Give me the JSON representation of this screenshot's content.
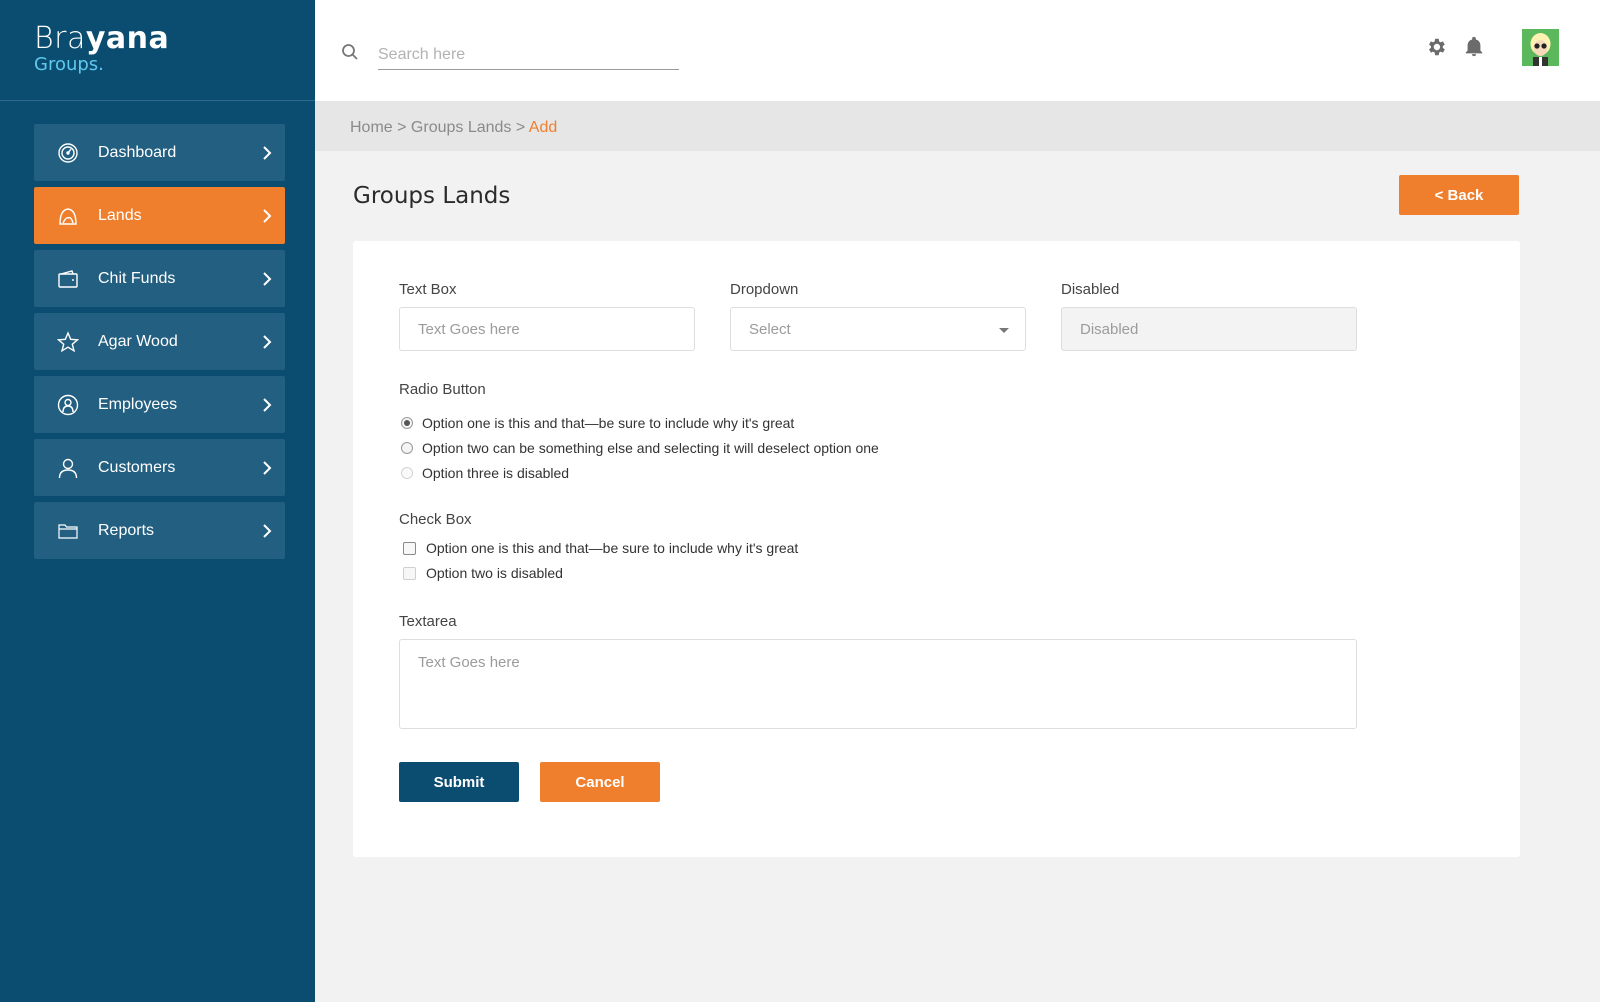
{
  "brand": {
    "name_light": "Bra",
    "name_bold": "yana",
    "sub": "Groups."
  },
  "colors": {
    "sidebar": "#0b4d70",
    "sidebar_item": "#235f80",
    "accent": "#ef7f2c",
    "primary": "#0b4d70"
  },
  "sidebar": {
    "items": [
      {
        "label": "Dashboard",
        "icon": "dashboard-gauge-icon",
        "active": false
      },
      {
        "label": "Lands",
        "icon": "lands-hill-icon",
        "active": true
      },
      {
        "label": "Chit Funds",
        "icon": "wallet-icon",
        "active": false
      },
      {
        "label": "Agar Wood",
        "icon": "star-icon",
        "active": false
      },
      {
        "label": "Employees",
        "icon": "employee-badge-icon",
        "active": false
      },
      {
        "label": "Customers",
        "icon": "user-icon",
        "active": false
      },
      {
        "label": "Reports",
        "icon": "folder-icon",
        "active": false
      }
    ]
  },
  "header": {
    "search_placeholder": "Search here",
    "icons": [
      "search-icon",
      "gear-icon",
      "bell-icon",
      "avatar"
    ]
  },
  "breadcrumb": {
    "home": "Home",
    "sep1": " > ",
    "section": "Groups Lands",
    "sep2": " > ",
    "current": "Add"
  },
  "page": {
    "title": "Groups Lands",
    "back_label": "< Back"
  },
  "form": {
    "text_box": {
      "label": "Text Box",
      "placeholder": "Text Goes here"
    },
    "dropdown": {
      "label": "Dropdown",
      "selected": "Select"
    },
    "disabled": {
      "label": "Disabled",
      "placeholder": "Disabled"
    },
    "radio": {
      "label": "Radio Button",
      "options": [
        {
          "text": "Option one is this and that—be sure to include why it's great",
          "checked": true,
          "disabled": false
        },
        {
          "text": "Option two can be something else and selecting it will deselect option one",
          "checked": false,
          "disabled": false
        },
        {
          "text": "Option three is disabled",
          "checked": false,
          "disabled": true
        }
      ]
    },
    "checkbox": {
      "label": "Check Box",
      "options": [
        {
          "text": "Option one is this and that—be sure to include why it's great",
          "checked": false,
          "disabled": false
        },
        {
          "text": "Option two is disabled",
          "checked": false,
          "disabled": true
        }
      ]
    },
    "textarea": {
      "label": "Textarea",
      "placeholder": "Text Goes here"
    },
    "submit_label": "Submit",
    "cancel_label": "Cancel"
  }
}
